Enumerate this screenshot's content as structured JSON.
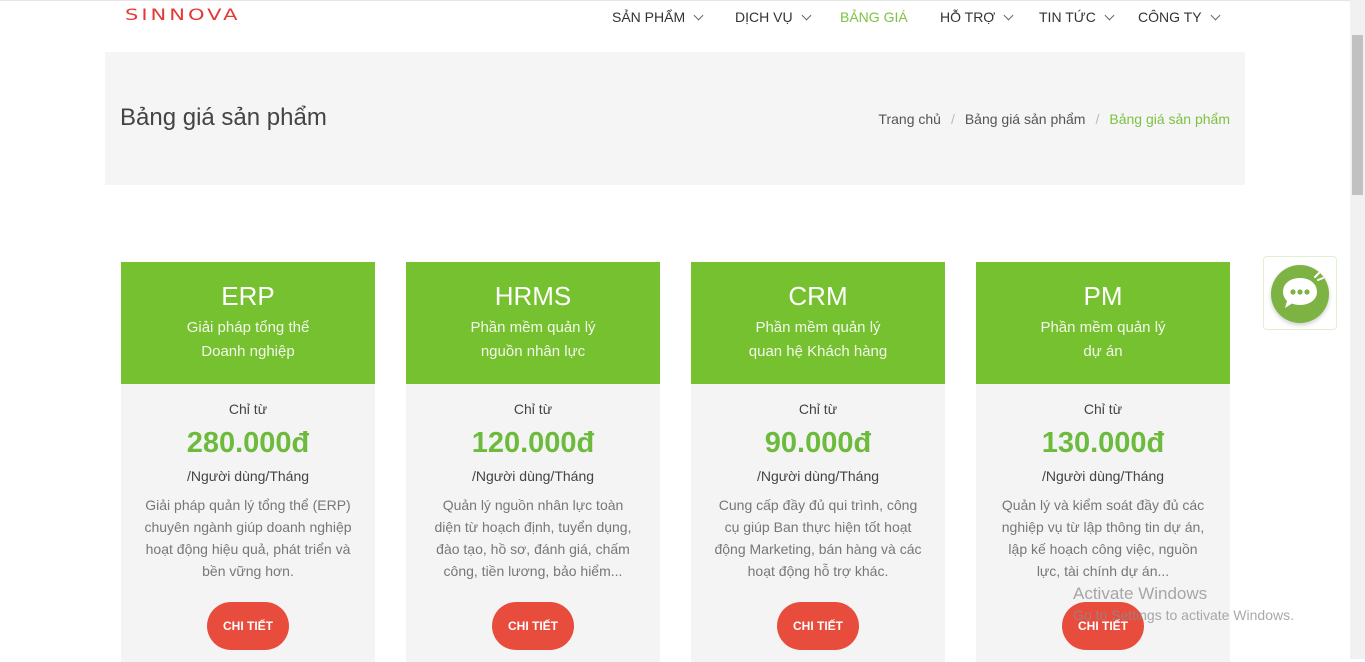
{
  "header": {
    "logo_text": "SINNOVA",
    "nav": [
      {
        "label": "SẢN PHẨM",
        "has_dropdown": true,
        "active": false
      },
      {
        "label": "DỊCH VỤ",
        "has_dropdown": true,
        "active": false
      },
      {
        "label": "BẢNG GIÁ",
        "has_dropdown": false,
        "active": true
      },
      {
        "label": "HỖ TRỢ",
        "has_dropdown": true,
        "active": false
      },
      {
        "label": "TIN TỨC",
        "has_dropdown": true,
        "active": false
      },
      {
        "label": "CÔNG TY",
        "has_dropdown": true,
        "active": false
      }
    ]
  },
  "banner": {
    "title": "Bảng giá sản phẩm",
    "breadcrumb": [
      "Trang chủ",
      "Bảng giá sản phẩm",
      "Bảng giá sản phẩm"
    ]
  },
  "cards": [
    {
      "name": "ERP",
      "sub1": "Giải pháp tổng thể",
      "sub2": "Doanh nghiệp",
      "from": "Chỉ từ",
      "price": "280.000đ",
      "unit": "/Người dùng/Tháng",
      "desc": "Giải pháp quản lý tổng thể (ERP) chuyên ngành giúp doanh nghiệp hoạt động hiệu quả, phát triển và bền vững hơn.",
      "button": "CHI TIẾT"
    },
    {
      "name": "HRMS",
      "sub1": "Phần mềm quản lý",
      "sub2": "nguồn nhân lực",
      "from": "Chỉ từ",
      "price": "120.000đ",
      "unit": "/Người dùng/Tháng",
      "desc": "Quản lý nguồn nhân lực toàn diện từ hoạch định, tuyển dụng, đào tạo, hồ sơ, đánh giá, chấm công, tiền lương, bảo hiểm...",
      "button": "CHI TIẾT"
    },
    {
      "name": "CRM",
      "sub1": "Phần mềm quản lý",
      "sub2": "quan hệ Khách hàng",
      "from": "Chỉ từ",
      "price": "90.000đ",
      "unit": "/Người dùng/Tháng",
      "desc": "Cung cấp đầy đủ qui trình, công cụ giúp Ban thực hiện tốt hoạt động Marketing, bán hàng và các hoạt động hỗ trợ khác.",
      "button": "CHI TIẾT"
    },
    {
      "name": "PM",
      "sub1": "Phần mềm quản lý",
      "sub2": "dự án",
      "from": "Chỉ từ",
      "price": "130.000đ",
      "unit": "/Người dùng/Tháng",
      "desc": "Quản lý và kiểm soát đầy đủ các nghiệp vụ từ lập thông tin dự án, lập kế hoạch công việc, nguồn lực, tài chính dự án...",
      "button": "CHI TIẾT"
    }
  ],
  "watermark": {
    "line1": "Activate Windows",
    "line2": "Go to Settings to activate Windows."
  },
  "colors": {
    "brand_green": "#76c12f",
    "price_green": "#6cbb3c",
    "button_red": "#e84c3d",
    "logo_red": "#e53935"
  }
}
